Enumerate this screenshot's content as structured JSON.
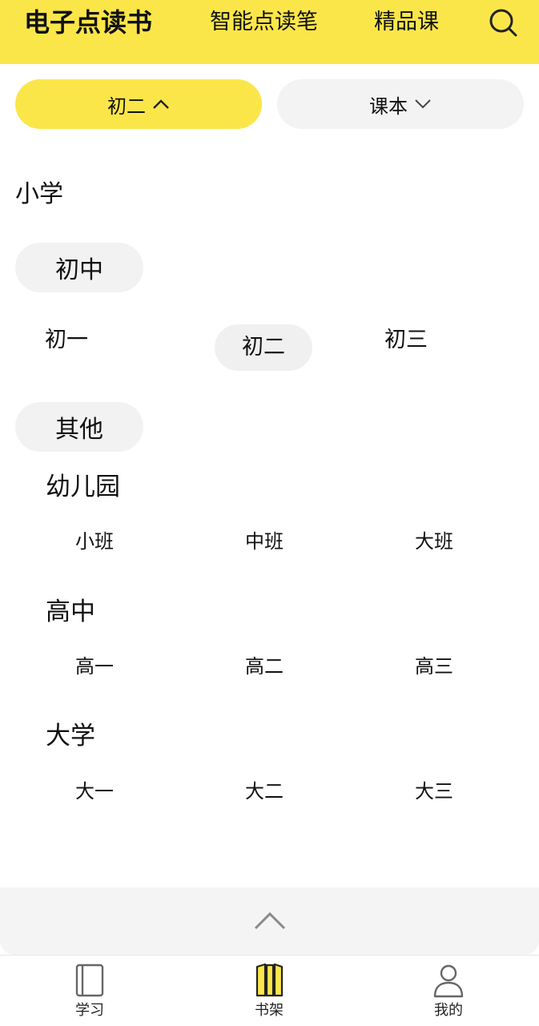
{
  "header": {
    "tabs": [
      {
        "label": "电子点读书"
      },
      {
        "label": "智能点读笔"
      },
      {
        "label": "精品课"
      }
    ],
    "search_icon": "search-icon"
  },
  "filters": {
    "grade_label": "初二",
    "type_label": "课本"
  },
  "dropdown": {
    "primary_school": "小学",
    "middle_school": {
      "label": "初中",
      "grades": [
        "初一",
        "初二",
        "初三"
      ],
      "selected": "初二"
    },
    "other": {
      "label": "其他",
      "groups": [
        {
          "label": "幼儿园",
          "options": [
            "小班",
            "中班",
            "大班"
          ]
        },
        {
          "label": "高中",
          "options": [
            "高一",
            "高二",
            "高三"
          ]
        },
        {
          "label": "大学",
          "options": [
            "大一",
            "大二",
            "大三"
          ]
        }
      ]
    }
  },
  "bottom_nav": [
    {
      "label": "学习",
      "icon": "book-icon"
    },
    {
      "label": "书架",
      "icon": "bookshelf-icon"
    },
    {
      "label": "我的",
      "icon": "person-icon"
    }
  ],
  "colors": {
    "accent": "#fbe64a",
    "chip_bg": "#f2f2f2"
  }
}
